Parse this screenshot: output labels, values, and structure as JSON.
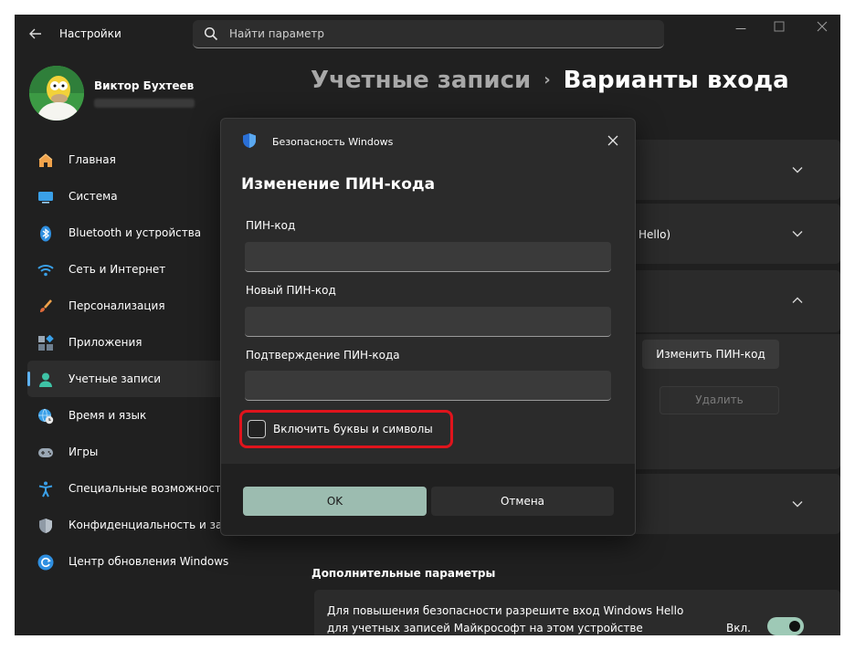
{
  "window": {
    "title": "Настройки",
    "search_placeholder": "Найти параметр"
  },
  "profile": {
    "name": "Виктор Бухтеев"
  },
  "sidebar": {
    "items": [
      {
        "label": "Главная",
        "icon": "home-icon"
      },
      {
        "label": "Система",
        "icon": "system-icon"
      },
      {
        "label": "Bluetooth и устройства",
        "icon": "bluetooth-icon"
      },
      {
        "label": "Сеть и Интернет",
        "icon": "wifi-icon"
      },
      {
        "label": "Персонализация",
        "icon": "brush-icon"
      },
      {
        "label": "Приложения",
        "icon": "apps-icon"
      },
      {
        "label": "Учетные записи",
        "icon": "account-icon",
        "active": true
      },
      {
        "label": "Время и язык",
        "icon": "globe-clock-icon"
      },
      {
        "label": "Игры",
        "icon": "gamepad-icon"
      },
      {
        "label": "Специальные возможности",
        "icon": "accessibility-icon"
      },
      {
        "label": "Конфиденциальность и защита",
        "icon": "shield-icon"
      },
      {
        "label": "Центр обновления Windows",
        "icon": "update-icon"
      }
    ]
  },
  "main": {
    "breadcrumb_parent": "Учетные записи",
    "breadcrumb_separator": "›",
    "breadcrumb_current": "Варианты входа",
    "card2_partial": "Hello)",
    "change_pin_button": "Изменить ПИН-код",
    "remove_button": "Удалить",
    "section_title": "Дополнительные параметры",
    "info_line1": "Для повышения безопасности разрешите вход Windows Hello",
    "info_line2": "для учетных записей Майкрософт на этом устройстве",
    "toggle_label": "Вкл.",
    "toggle_on": true
  },
  "dialog": {
    "caption": "Безопасность Windows",
    "title": "Изменение ПИН-кода",
    "fields": [
      {
        "label": "ПИН-код",
        "value": ""
      },
      {
        "label": "Новый ПИН-код",
        "value": ""
      },
      {
        "label": "Подтверждение ПИН-кода",
        "value": ""
      }
    ],
    "checkbox_label": "Включить буквы и символы",
    "checkbox_checked": false,
    "ok_label": "OK",
    "cancel_label": "Отмена"
  },
  "colors": {
    "accent": "#5fb2f2",
    "highlight_border": "#e0141c",
    "ok_button": "#9cbcb0",
    "toggle_on": "#9ec9b6"
  }
}
